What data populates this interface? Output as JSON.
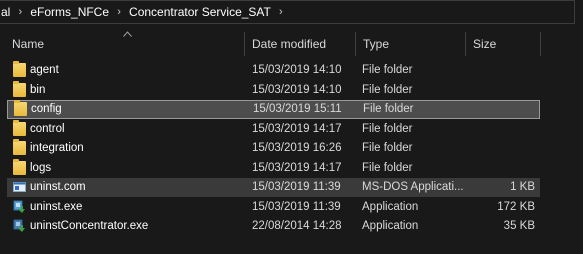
{
  "breadcrumb": {
    "items": [
      "al",
      "eForms_NFCe",
      "Concentrator Service_SAT"
    ],
    "separator": "›"
  },
  "columns": {
    "name": "Name",
    "date": "Date modified",
    "type": "Type",
    "size": "Size"
  },
  "files": [
    {
      "name": "agent",
      "date": "15/03/2019 14:10",
      "type": "File folder",
      "size": "",
      "icon": "folder-icon"
    },
    {
      "name": "bin",
      "date": "15/03/2019 14:10",
      "type": "File folder",
      "size": "",
      "icon": "folder-icon"
    },
    {
      "name": "config",
      "date": "15/03/2019 15:11",
      "type": "File folder",
      "size": "",
      "icon": "folder-icon"
    },
    {
      "name": "control",
      "date": "15/03/2019 14:17",
      "type": "File folder",
      "size": "",
      "icon": "folder-icon"
    },
    {
      "name": "integration",
      "date": "15/03/2019 16:26",
      "type": "File folder",
      "size": "",
      "icon": "folder-icon"
    },
    {
      "name": "logs",
      "date": "15/03/2019 14:17",
      "type": "File folder",
      "size": "",
      "icon": "folder-icon"
    },
    {
      "name": "uninst.com",
      "date": "15/03/2019 11:39",
      "type": "MS-DOS Applicati...",
      "size": "1 KB",
      "icon": "msdos-app-icon"
    },
    {
      "name": "uninst.exe",
      "date": "15/03/2019 11:39",
      "type": "Application",
      "size": "172 KB",
      "icon": "installer-icon"
    },
    {
      "name": "uninstConcentrator.exe",
      "date": "22/08/2014 14:28",
      "type": "Application",
      "size": "35 KB",
      "icon": "installer-icon"
    }
  ],
  "colors": {
    "background": "#191919",
    "selected_bg": "#4d4d4d",
    "hover_bg": "#3a3a3a",
    "folder": "#f0c850"
  }
}
